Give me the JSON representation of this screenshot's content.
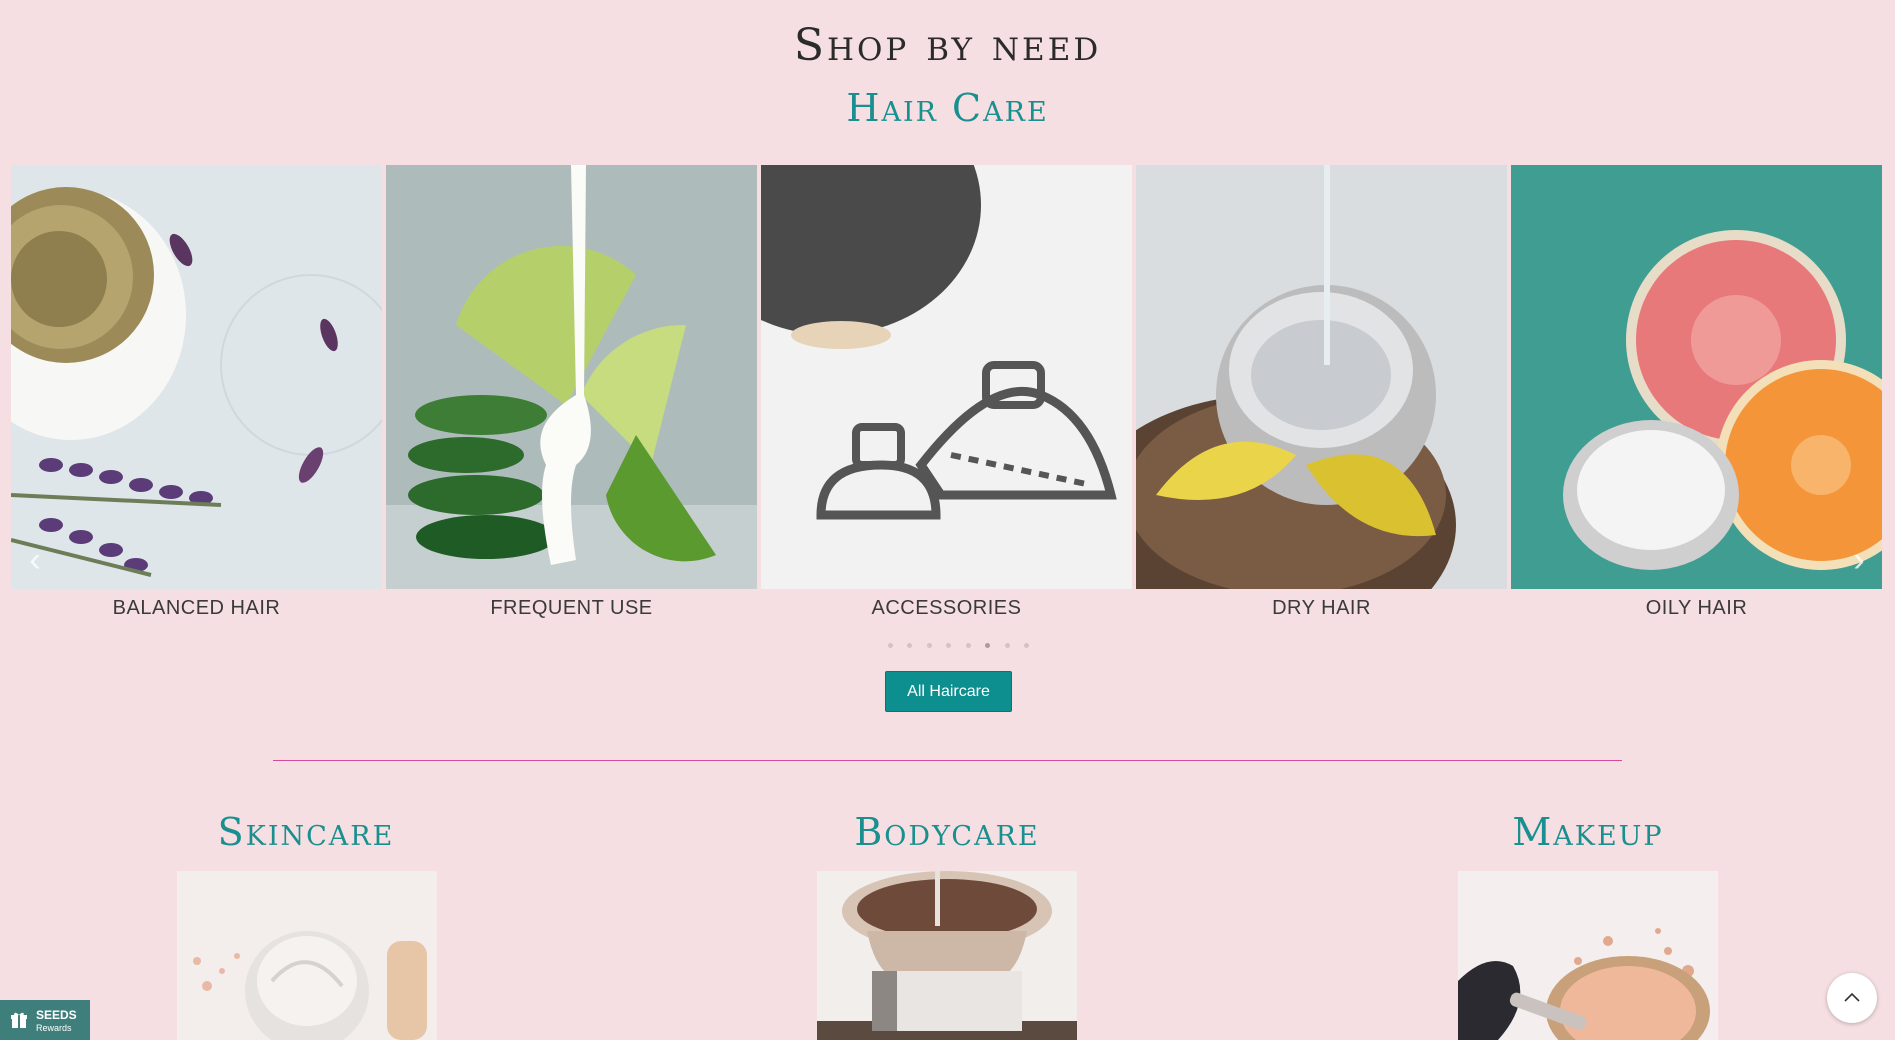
{
  "header": {
    "title": "Shop by need"
  },
  "haircare": {
    "title": "Hair Care",
    "items": [
      {
        "label": "BALANCED HAIR",
        "image": "lavender-oil-bowl"
      },
      {
        "label": "FREQUENT USE",
        "image": "aloe-lime-cream"
      },
      {
        "label": "ACCESSORIES",
        "image": "hair-claw-clips"
      },
      {
        "label": "DRY HAIR",
        "image": "coconut-bowl"
      },
      {
        "label": "OILY HAIR",
        "image": "grapefruit-cream"
      }
    ],
    "prev_icon": "chevron-left-icon",
    "next_icon": "chevron-right-icon",
    "pagination": {
      "total": 8,
      "active": 6
    },
    "button_label": "All Haircare"
  },
  "categories": [
    {
      "title": "Skincare",
      "image": "cream-jar"
    },
    {
      "title": "Bodycare",
      "image": "chocolate-bowl"
    },
    {
      "title": "Makeup",
      "image": "brush-powder"
    }
  ],
  "rewards": {
    "title": "SEEDS",
    "subtitle": "Rewards",
    "icon": "gift-icon"
  },
  "back_to_top": {
    "icon": "chevron-up-icon"
  },
  "colors": {
    "background": "#f5dfe2",
    "accent": "#0e8f8f",
    "divider": "#d64a9a"
  }
}
